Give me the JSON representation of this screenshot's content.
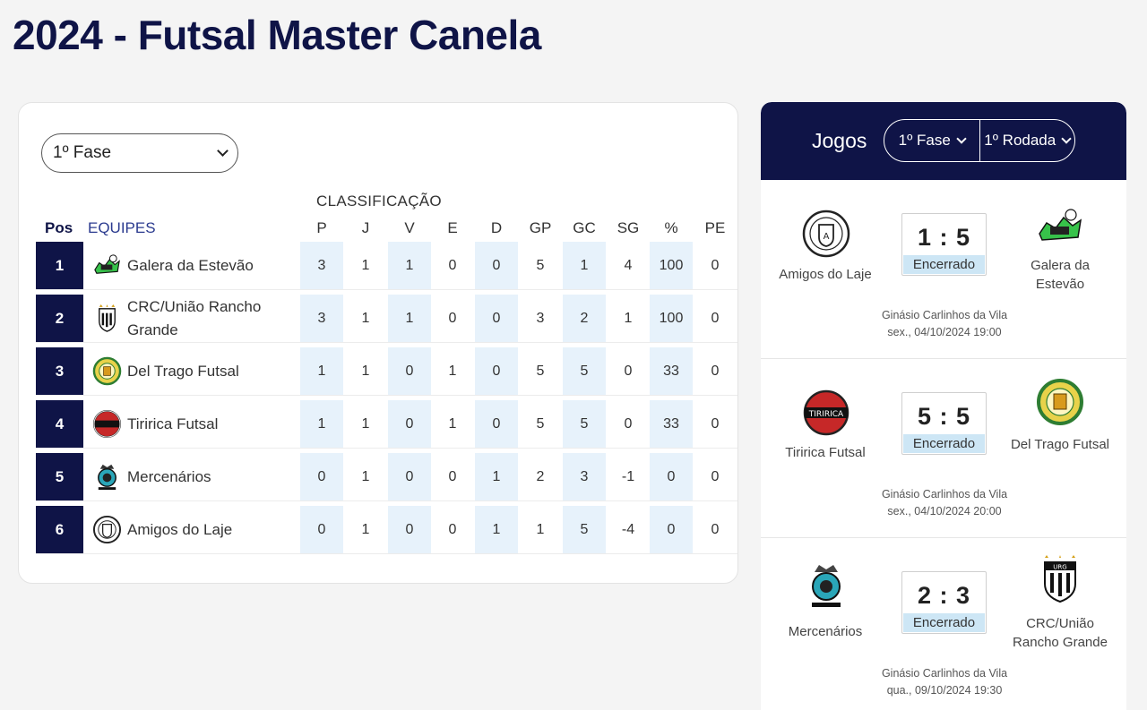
{
  "page": {
    "title": "2024 - Futsal Master Canela"
  },
  "standings": {
    "phase_select": {
      "value": "1º Fase"
    },
    "section_label": "CLASSIFICAÇÃO",
    "headers": {
      "pos": "Pos",
      "team": "EQUIPES",
      "stats": [
        "P",
        "J",
        "V",
        "E",
        "D",
        "GP",
        "GC",
        "SG",
        "%",
        "PE"
      ]
    },
    "rows": [
      {
        "pos": "1",
        "team": "Galera da Estevão",
        "stats": [
          "3",
          "1",
          "1",
          "0",
          "0",
          "5",
          "1",
          "4",
          "100",
          "0"
        ]
      },
      {
        "pos": "2",
        "team": "CRC/União Rancho Grande",
        "stats": [
          "3",
          "1",
          "1",
          "0",
          "0",
          "3",
          "2",
          "1",
          "100",
          "0"
        ]
      },
      {
        "pos": "3",
        "team": "Del Trago Futsal",
        "stats": [
          "1",
          "1",
          "0",
          "1",
          "0",
          "5",
          "5",
          "0",
          "33",
          "0"
        ]
      },
      {
        "pos": "4",
        "team": "Tiririca Futsal",
        "stats": [
          "1",
          "1",
          "0",
          "1",
          "0",
          "5",
          "5",
          "0",
          "33",
          "0"
        ]
      },
      {
        "pos": "5",
        "team": "Mercenários",
        "stats": [
          "0",
          "1",
          "0",
          "0",
          "1",
          "2",
          "3",
          "-1",
          "0",
          "0"
        ]
      },
      {
        "pos": "6",
        "team": "Amigos do Laje",
        "stats": [
          "0",
          "1",
          "0",
          "0",
          "1",
          "1",
          "5",
          "-4",
          "0",
          "0"
        ]
      }
    ]
  },
  "games": {
    "title": "Jogos",
    "phase_filter": "1º Fase",
    "round_filter": "1º Rodada",
    "matches": [
      {
        "home": "Amigos do Laje",
        "away": "Galera da Estevão",
        "score": "1 : 5",
        "status": "Encerrado",
        "venue": "Ginásio Carlinhos da Vila",
        "datetime": "sex., 04/10/2024 19:00"
      },
      {
        "home": "Tiririca Futsal",
        "away": "Del Trago Futsal",
        "score": "5 : 5",
        "status": "Encerrado",
        "venue": "Ginásio Carlinhos da Vila",
        "datetime": "sex., 04/10/2024 20:00"
      },
      {
        "home": "Mercenários",
        "away": "CRC/União Rancho Grande",
        "score": "2 : 3",
        "status": "Encerrado",
        "venue": "Ginásio Carlinhos da Vila",
        "datetime": "qua., 09/10/2024 19:30"
      }
    ]
  },
  "colors": {
    "navy": "#0f1447",
    "shade": "#e7f2fb",
    "badge": "#cde6f5"
  }
}
